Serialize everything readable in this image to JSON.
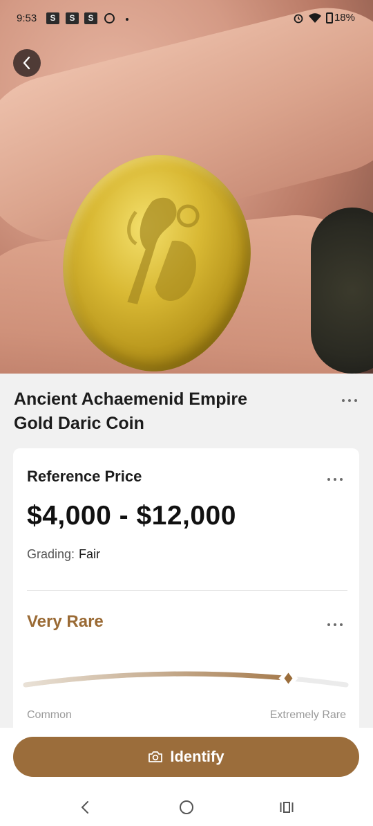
{
  "status_bar": {
    "time": "9:53",
    "notif_letters": [
      "S",
      "S",
      "S"
    ],
    "battery": "18%"
  },
  "item": {
    "title_line1": "Ancient Achaemenid Empire",
    "title_line2": "Gold Daric Coin"
  },
  "price_card": {
    "label": "Reference Price",
    "value": "$4,000 - $12,000",
    "grading_label": "Grading:",
    "grading_value": "Fair"
  },
  "rarity": {
    "label": "Very Rare",
    "scale_min": "Common",
    "scale_max": "Extremely Rare",
    "level": 0.82
  },
  "actions": {
    "identify_label": "Identify"
  },
  "colors": {
    "accent": "#9b6d3b",
    "rarity_text": "#9a6a34"
  },
  "icons": {
    "back": "chevron-left-icon",
    "camera": "camera-icon",
    "more": "more-dots-icon"
  }
}
